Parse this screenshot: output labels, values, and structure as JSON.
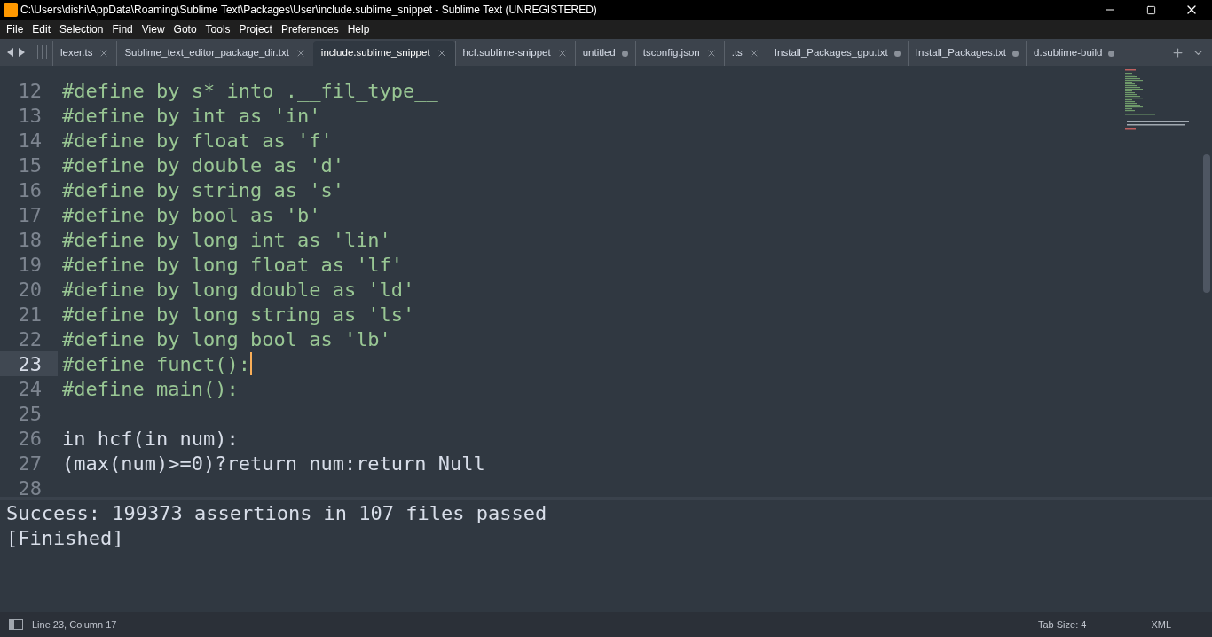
{
  "window": {
    "title": "C:\\Users\\dishi\\AppData\\Roaming\\Sublime Text\\Packages\\User\\include.sublime_snippet - Sublime Text (UNREGISTERED)"
  },
  "menu": [
    "File",
    "Edit",
    "Selection",
    "Find",
    "View",
    "Goto",
    "Tools",
    "Project",
    "Preferences",
    "Help"
  ],
  "tabs": [
    {
      "label": "lexer.ts",
      "selected": false,
      "dirty": false
    },
    {
      "label": "Sublime_text_editor_package_dir.txt",
      "selected": false,
      "dirty": false
    },
    {
      "label": "include.sublime_snippet",
      "selected": true,
      "dirty": false
    },
    {
      "label": "hcf.sublime-snippet",
      "selected": false,
      "dirty": false
    },
    {
      "label": "untitled",
      "selected": false,
      "dirty": true
    },
    {
      "label": "tsconfig.json",
      "selected": false,
      "dirty": false
    },
    {
      "label": ".ts",
      "selected": false,
      "dirty": false
    },
    {
      "label": "Install_Packages_gpu.txt",
      "selected": false,
      "dirty": true
    },
    {
      "label": "Install_Packages.txt",
      "selected": false,
      "dirty": true
    },
    {
      "label": "d.sublime-build",
      "selected": false,
      "dirty": true
    }
  ],
  "editor": {
    "lines": [
      {
        "number": "12",
        "text": "#define by s* into .__fil_type__",
        "kind": "directive",
        "selected": false
      },
      {
        "number": "13",
        "text": "#define by int as 'in'",
        "kind": "directive",
        "selected": false
      },
      {
        "number": "14",
        "text": "#define by float as 'f'",
        "kind": "directive",
        "selected": false
      },
      {
        "number": "15",
        "text": "#define by double as 'd'",
        "kind": "directive",
        "selected": false
      },
      {
        "number": "16",
        "text": "#define by string as 's'",
        "kind": "directive",
        "selected": false
      },
      {
        "number": "17",
        "text": "#define by bool as 'b'",
        "kind": "directive",
        "selected": false
      },
      {
        "number": "18",
        "text": "#define by long int as 'lin'",
        "kind": "directive",
        "selected": false
      },
      {
        "number": "19",
        "text": "#define by long float as 'lf'",
        "kind": "directive",
        "selected": false
      },
      {
        "number": "20",
        "text": "#define by long double as 'ld'",
        "kind": "directive",
        "selected": false
      },
      {
        "number": "21",
        "text": "#define by long string as 'ls'",
        "kind": "directive",
        "selected": false
      },
      {
        "number": "22",
        "text": "#define by long bool as 'lb'",
        "kind": "directive",
        "selected": false
      },
      {
        "number": "23",
        "text": "#define funct():",
        "kind": "directive",
        "selected": true
      },
      {
        "number": "24",
        "text": "#define main():",
        "kind": "directive",
        "selected": false
      },
      {
        "number": "25",
        "kind": "blank",
        "selected": false
      },
      {
        "number": "26",
        "text": "in hcf(in num):",
        "kind": "code",
        "selected": false
      },
      {
        "number": "27",
        "text": "(max(num)>=0)?return num:return Null",
        "kind": "code",
        "selected": false
      },
      {
        "number": "28",
        "kind": "blank",
        "selected": false
      }
    ]
  },
  "output": [
    "Success: 199373 assertions in 107 files passed",
    "[Finished]"
  ],
  "status_bar": {
    "position": "Line 23, Column 17",
    "tab_size": "Tab Size: 4",
    "syntax": "XML"
  }
}
